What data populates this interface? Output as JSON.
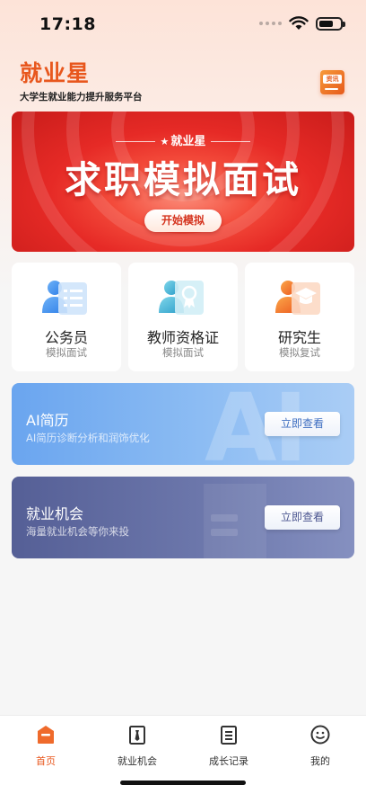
{
  "status_bar": {
    "time": "17:18"
  },
  "header": {
    "title": "就业星",
    "subtitle": "大学生就业能力提升服务平台",
    "news_icon_label": "资讯"
  },
  "banner": {
    "brand": "就业星",
    "title": "求职模拟面试",
    "button": "开始模拟"
  },
  "categories": [
    {
      "label": "公务员",
      "sub": "模拟面试",
      "icon": "civil-servant-icon"
    },
    {
      "label": "教师资格证",
      "sub": "模拟面试",
      "icon": "teacher-certificate-icon"
    },
    {
      "label": "研究生",
      "sub": "模拟复试",
      "icon": "graduate-cap-icon"
    }
  ],
  "features": [
    {
      "title": "AI简历",
      "sub": "AI简历诊断分析和润饰优化",
      "button": "立即查看",
      "deco": "AI"
    },
    {
      "title": "就业机会",
      "sub": "海量就业机会等你来投",
      "button": "立即查看"
    }
  ],
  "tabs": [
    {
      "label": "首页",
      "icon": "home-icon",
      "active": true
    },
    {
      "label": "就业机会",
      "icon": "tie-icon",
      "active": false
    },
    {
      "label": "成长记录",
      "icon": "record-icon",
      "active": false
    },
    {
      "label": "我的",
      "icon": "profile-icon",
      "active": false
    }
  ],
  "colors": {
    "brand": "#e8571d",
    "banner_red": "#e62a26",
    "ai_blue": "#6aa5ef",
    "job_indigo": "#555f96"
  }
}
